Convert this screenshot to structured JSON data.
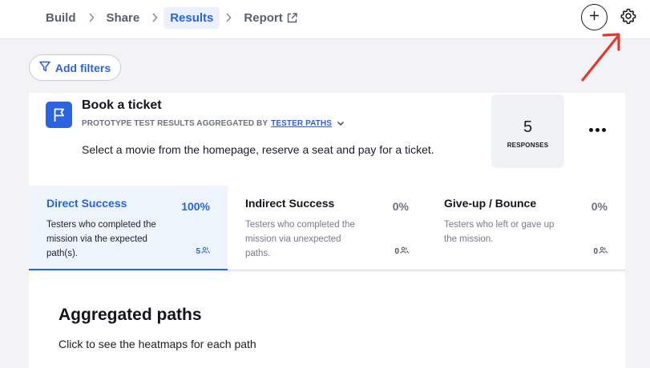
{
  "nav": {
    "crumbs": [
      {
        "label": "Build"
      },
      {
        "label": "Share"
      },
      {
        "label": "Results"
      },
      {
        "label": "Report"
      }
    ],
    "active_index": 2
  },
  "filters": {
    "add_label": "Add filters"
  },
  "test": {
    "title": "Book a ticket",
    "subtitle_prefix": "PROTOTYPE TEST RESULTS AGGREGATED BY",
    "subtitle_link": "TESTER PATHS",
    "description": "Select a movie from the homepage, reserve a seat and pay for a ticket.",
    "responses": {
      "count": "5",
      "label": "RESPONSES"
    }
  },
  "stats": [
    {
      "title": "Direct Success",
      "percent": "100%",
      "description": "Testers who completed the mission via the expected path(s).",
      "count": "5"
    },
    {
      "title": "Indirect Success",
      "percent": "0%",
      "description": "Testers who completed the mission via unexpected paths.",
      "count": "0"
    },
    {
      "title": "Give-up / Bounce",
      "percent": "0%",
      "description": "Testers who left or gave up the mission.",
      "count": "0"
    }
  ],
  "paths": {
    "title": "Aggregated paths",
    "subtitle": "Click to see the heatmaps for each path"
  },
  "colors": {
    "accent": "#2563eb",
    "annotation_arrow": "#e03a2f"
  }
}
